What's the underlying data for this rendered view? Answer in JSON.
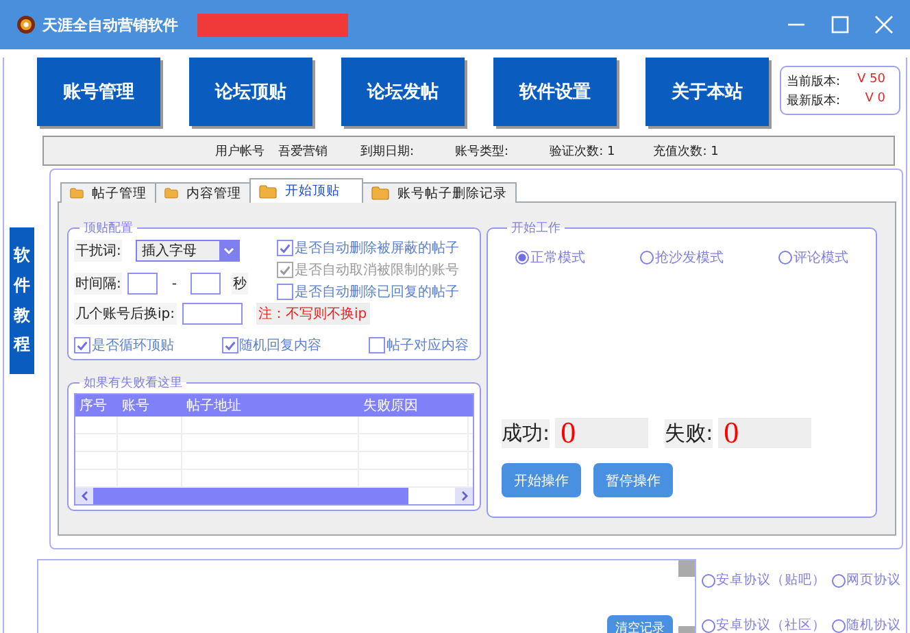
{
  "window": {
    "title": "天涯全自动营销软件"
  },
  "nav_buttons": [
    "账号管理",
    "论坛顶贴",
    "论坛发帖",
    "软件设置",
    "关于本站"
  ],
  "version": {
    "current_label": "当前版本:",
    "current": "V 50",
    "latest_label": "最新版本:",
    "latest": "V 0"
  },
  "info_bar": [
    "用户帐号",
    "吾爱营销",
    "到期日期:",
    "账号类型:",
    "验证次数: 1",
    "充值次数: 1"
  ],
  "sidebar_button": "软件教程",
  "tabs": [
    {
      "label": "帖子管理",
      "selected": false
    },
    {
      "label": "内容管理",
      "selected": false
    },
    {
      "label": "开始顶贴",
      "selected": true
    },
    {
      "label": "账号帖子删除记录",
      "selected": false
    }
  ],
  "config": {
    "title": "顶贴配置",
    "interference_label": "干扰词:",
    "interference_value": "插入字母",
    "interval_label": "时间隔:",
    "interval_sep": "-",
    "interval_unit": "秒",
    "switch_ip_label": "几个账号后换ip:",
    "note": "注：不写则不换ip",
    "options": [
      {
        "label": "是否自动删除被屏蔽的帖子",
        "checked": true,
        "disabled": false
      },
      {
        "label": "是否自动取消被限制的账号",
        "checked": true,
        "disabled": true
      },
      {
        "label": "是否自动删除已回复的帖子",
        "checked": false,
        "disabled": false
      },
      {
        "label": "是否循环顶贴",
        "checked": true,
        "disabled": false
      },
      {
        "label": "随机回复内容",
        "checked": true,
        "disabled": false
      },
      {
        "label": "帖子对应内容",
        "checked": false,
        "disabled": false
      }
    ]
  },
  "failures": {
    "title": "如果有失败看这里",
    "columns": [
      "序号",
      "账号",
      "帖子地址",
      "失败原因"
    ]
  },
  "work": {
    "title": "开始工作",
    "modes": [
      {
        "label": "正常模式",
        "selected": true
      },
      {
        "label": "抢沙发模式",
        "selected": false
      },
      {
        "label": "评论模式",
        "selected": false
      }
    ],
    "success_label": "成功:",
    "success": "0",
    "fail_label": "失败:",
    "fail": "0",
    "buttons": [
      "开始操作",
      "暂停操作"
    ]
  },
  "log": {
    "clear_button": "清空记录"
  },
  "protocols": [
    {
      "label": "安卓协议（贴吧）",
      "selected": false
    },
    {
      "label": "网页协议",
      "selected": false
    },
    {
      "label": "安卓协议（社区）",
      "selected": false
    },
    {
      "label": "随机协议",
      "selected": false
    }
  ]
}
